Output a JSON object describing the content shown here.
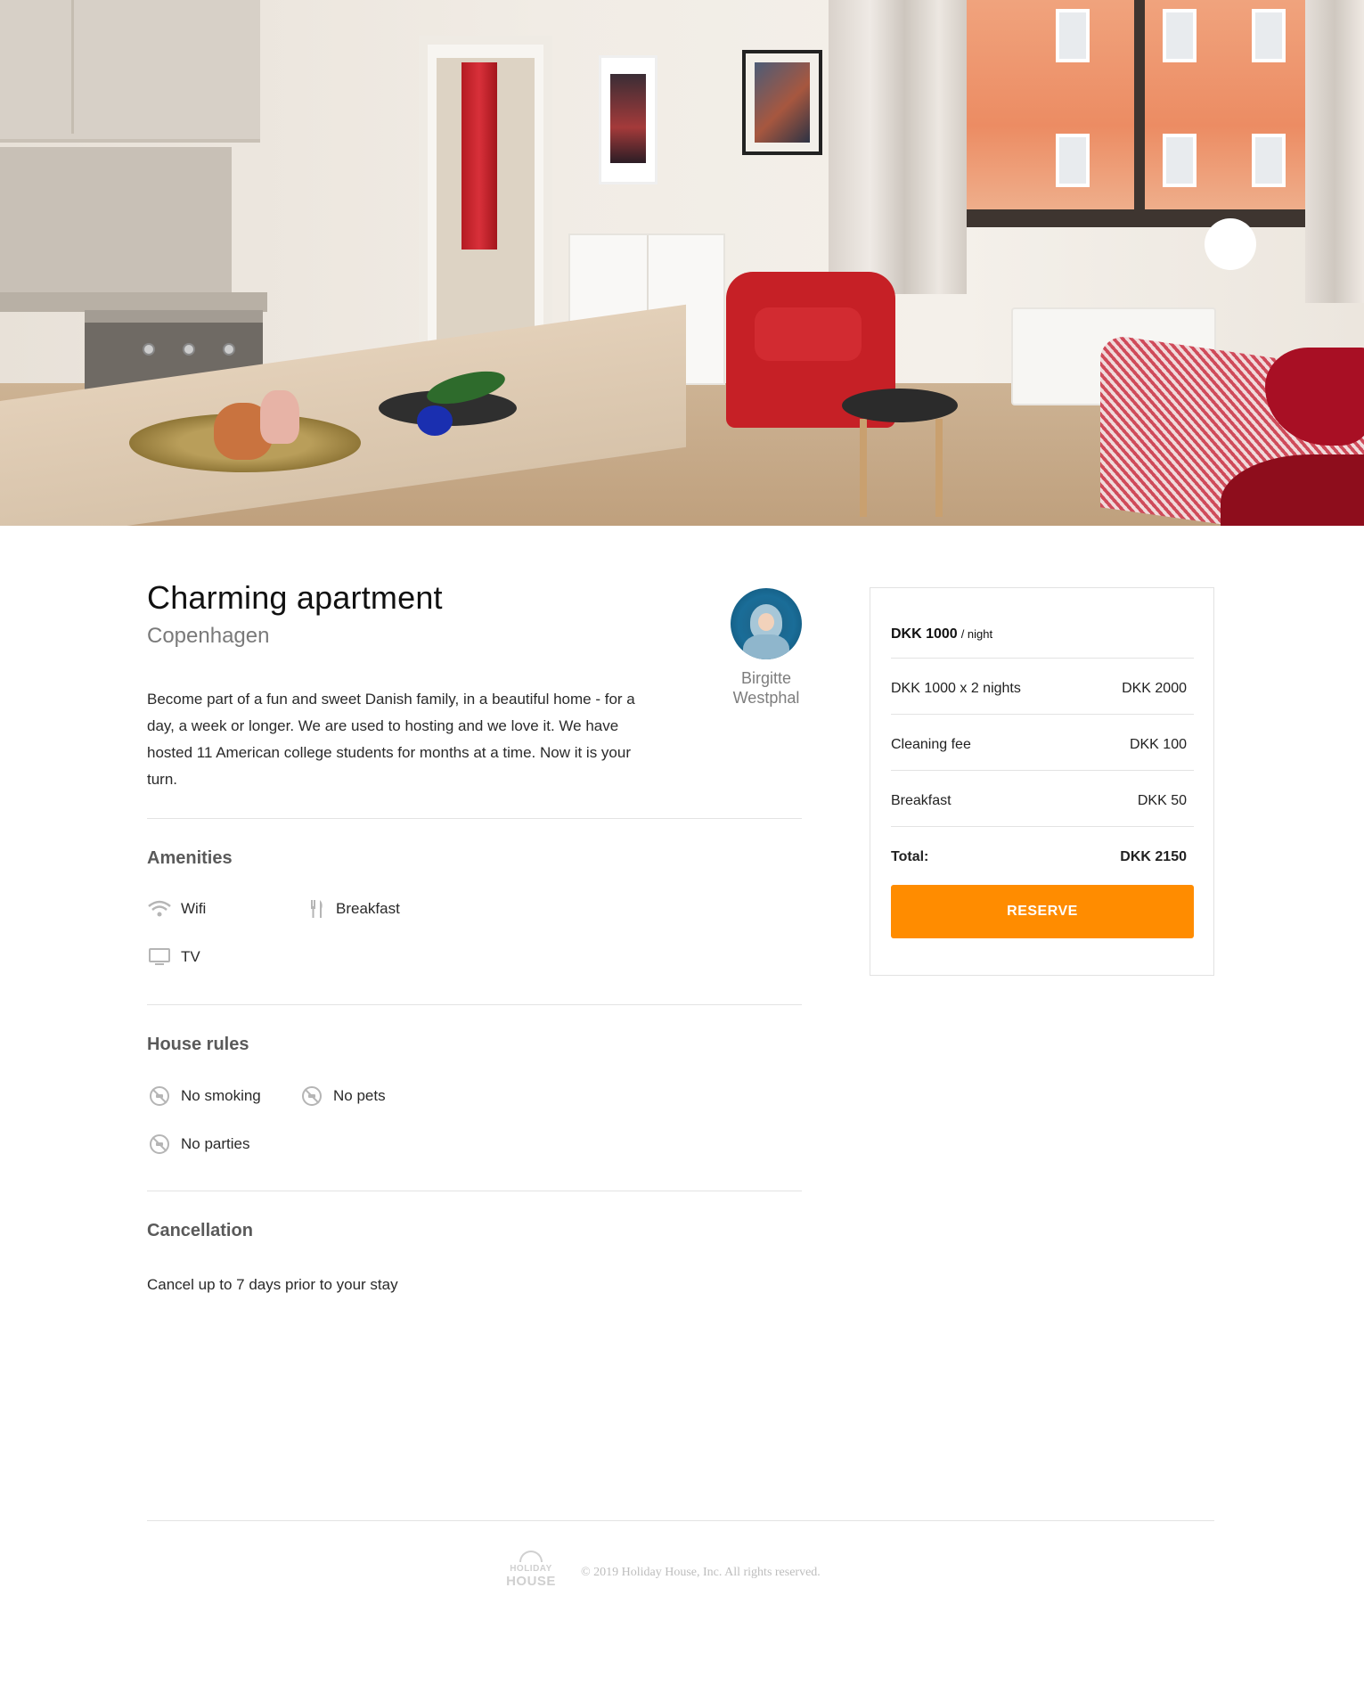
{
  "listing": {
    "title": "Charming apartment",
    "city": "Copenhagen",
    "description": "Become part of a fun and sweet Danish family, in a beautiful home - for a day, a week or longer. We are used to hosting and we love it. We have hosted 11 American college students for months at a time. Now it is your turn.",
    "host": {
      "name": "Birgitte Westphal"
    }
  },
  "amenities": {
    "title": "Amenities",
    "items": [
      {
        "label": "Wifi",
        "icon": "wifi-icon"
      },
      {
        "label": "Breakfast",
        "icon": "cutlery-icon"
      },
      {
        "label": "TV",
        "icon": "tv-icon"
      }
    ]
  },
  "rules": {
    "title": "House rules",
    "items": [
      {
        "label": "No smoking",
        "icon": "no-smoking-icon"
      },
      {
        "label": "No pets",
        "icon": "no-pets-icon"
      },
      {
        "label": "No parties",
        "icon": "no-parties-icon"
      }
    ]
  },
  "cancellation": {
    "title": "Cancellation",
    "text": "Cancel up to 7 days prior to your stay"
  },
  "booking": {
    "price": "DKK 1000",
    "unit": "/ night",
    "rows": [
      {
        "label": "DKK 1000 x 2 nights",
        "value": "DKK 2000"
      },
      {
        "label": "Cleaning fee",
        "value": "DKK 100"
      },
      {
        "label": "Breakfast",
        "value": "DKK 50"
      }
    ],
    "total_label": "Total:",
    "total_value": "DKK 2150",
    "reserve_label": "RESERVE"
  },
  "footer": {
    "logo_line1": "HOLIDAY",
    "logo_line2": "HOUSE",
    "copyright": "© 2019 Holiday House, Inc. All rights reserved."
  },
  "colors": {
    "accent": "#ff8c00",
    "text": "#222222",
    "muted": "#7a7a7a",
    "divider": "#e3e3e3"
  }
}
